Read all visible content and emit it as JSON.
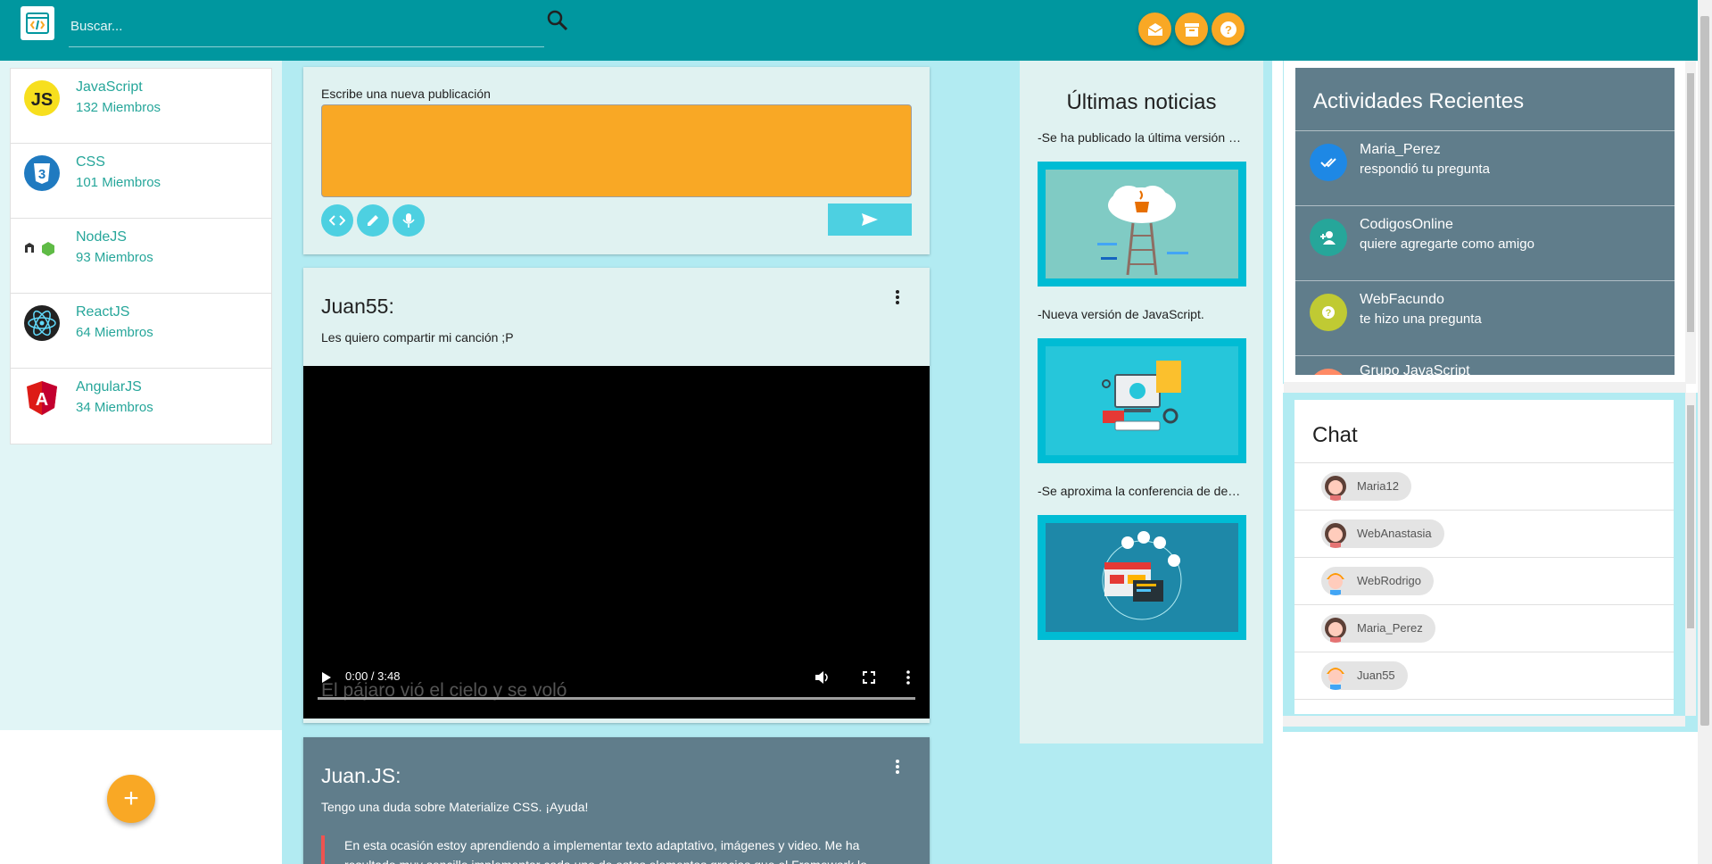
{
  "header": {
    "search_placeholder": "Buscar...",
    "actions": [
      {
        "name": "messages-button",
        "icon": "envelope-open-icon"
      },
      {
        "name": "archive-button",
        "icon": "archive-icon"
      },
      {
        "name": "help-button",
        "icon": "help-circle-icon"
      }
    ]
  },
  "groups": [
    {
      "name": "JavaScript",
      "members": "132 Miembros",
      "icon": "javascript-logo-icon"
    },
    {
      "name": "CSS",
      "members": "101 Miembros",
      "icon": "css3-logo-icon"
    },
    {
      "name": "NodeJS",
      "members": "93 Miembros",
      "icon": "nodejs-logo-icon"
    },
    {
      "name": "ReactJS",
      "members": "64 Miembros",
      "icon": "react-logo-icon"
    },
    {
      "name": "AngularJS",
      "members": "34 Miembros",
      "icon": "angular-logo-icon"
    }
  ],
  "fab_label": "+",
  "composer": {
    "label": "Escribe una nueva publicación",
    "buttons": [
      "code-icon",
      "pencil-icon",
      "microphone-icon"
    ],
    "send_icon": "send-icon"
  },
  "posts": [
    {
      "author": "Juan55:",
      "text": "Les quiero compartir mi canción ;P",
      "video": {
        "time": "0:00 / 3:48",
        "caption": "El pájaro vió el cielo y se voló"
      }
    },
    {
      "author": "Juan.JS:",
      "text": "Tengo una duda sobre Materialize CSS. ¡Ayuda!",
      "quote": "En esta ocasión estoy aprendiendo a implementar texto adaptativo, imágenes y video. Me ha resultado muy sencillo implementar cada uno de estos elementos gracias que el Framework lo"
    }
  ],
  "news": {
    "title": "Últimas noticias",
    "items": [
      {
        "text": "-Se ha publicado la última versión de Java.",
        "image": "java-cloud-illustration"
      },
      {
        "text": "-Nueva versión de JavaScript.",
        "image": "developer-workspace-illustration"
      },
      {
        "text": "-Se aproxima la conferencia de desarrolladores.",
        "image": "web-devices-illustration"
      }
    ]
  },
  "activity": {
    "title": "Actividades Recientes",
    "items": [
      {
        "name": "Maria_Perez",
        "desc": "respondió tu pregunta",
        "icon": "double-check-icon",
        "color": "#1e88e5"
      },
      {
        "name": "CodigosOnline",
        "desc": "quiere agregarte como amigo",
        "icon": "person-add-icon",
        "color": "#26a69a"
      },
      {
        "name": "WebFacundo",
        "desc": "te hizo una pregunta",
        "icon": "question-icon",
        "color": "#c0ca33"
      },
      {
        "name": "Grupo JavaScript",
        "desc": "",
        "icon": "group-icon",
        "color": "#ff8a65"
      }
    ]
  },
  "chat": {
    "title": "Chat",
    "users": [
      {
        "name": "Maria12",
        "avatar": "female-avatar-icon"
      },
      {
        "name": "WebAnastasia",
        "avatar": "female-avatar-icon"
      },
      {
        "name": "WebRodrigo",
        "avatar": "male-avatar-icon"
      },
      {
        "name": "Maria_Perez",
        "avatar": "female-avatar-icon"
      },
      {
        "name": "Juan55",
        "avatar": "male-avatar-icon"
      }
    ]
  },
  "colors": {
    "primary": "#00979f",
    "accent": "#f9a825",
    "cyan": "#4dd0e1",
    "slate": "#607d8b"
  }
}
